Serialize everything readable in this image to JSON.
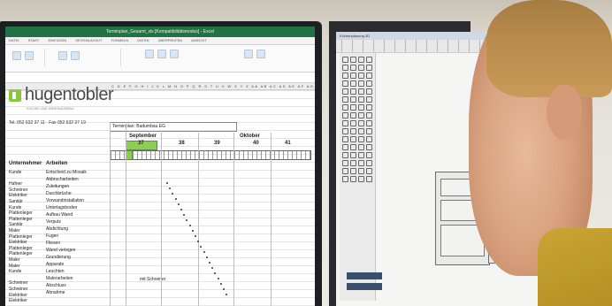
{
  "scene": {
    "description_label": "Office workstation photo"
  },
  "left_monitor": {
    "window_title": "Terminplan_Gesamt_xls [Kompatibilitätsmodus] - Excel",
    "ribbon_tabs": [
      "DATEI",
      "START",
      "EINFÜGEN",
      "SEITENLAYOUT",
      "FORMELN",
      "DATEN",
      "ÜBERPRÜFEN",
      "ANSICHT"
    ],
    "company": "hugentobler",
    "company_sub": "KÜCHE UND INNENAUSBAU",
    "ticket": "Tel. 052 632 37 11 · Fax 052 632 37 19",
    "sheet_title": "Terminplan: Badumbau EG",
    "col_header_left": "Unternehmer",
    "col_header_right": "Arbeiten",
    "month_1": "September",
    "month_2": "Oktober",
    "week_1": "37",
    "week_2": "38",
    "week_3": "39",
    "week_4": "40",
    "week_5": "41",
    "rows_left": [
      "Kunde",
      "",
      "Hafner",
      "Schreiner",
      "Elektriker",
      "Sanitär",
      "Kunde",
      "Plattenleger",
      "Plattenleger",
      "Sanitär",
      "Maler",
      "Plattenleger",
      "Elektriker",
      "Plattenleger",
      "Plattenleger",
      "Maler",
      "Maler",
      "Kunde",
      "",
      "Schreiner",
      "Schreiner",
      "Elektriker",
      "Elektriker"
    ],
    "rows_right": [
      "Entscheid zu Mosaik",
      "Abbrucharbeiten",
      "Zuleitungen",
      "Durchbrüche",
      "Vorwandinstallation",
      "Unterlagsboden",
      "Aufbau Wand",
      "Verputz",
      "Abdichtung",
      "Fugen",
      "Fliesen",
      "Wand verlegen",
      "Grundierung",
      "Apparate",
      "Leuchten",
      "Malerarbeiten",
      "Abschluss",
      "Abnahme"
    ],
    "note": "mit Schreiner"
  },
  "right_monitor": {
    "window_title": "Küchenplanung 3D",
    "app_brand": "Cabinet"
  },
  "colors": {
    "excel_green": "#217346",
    "highlight_green": "#8ccd55",
    "shirt": "#c9a534"
  }
}
